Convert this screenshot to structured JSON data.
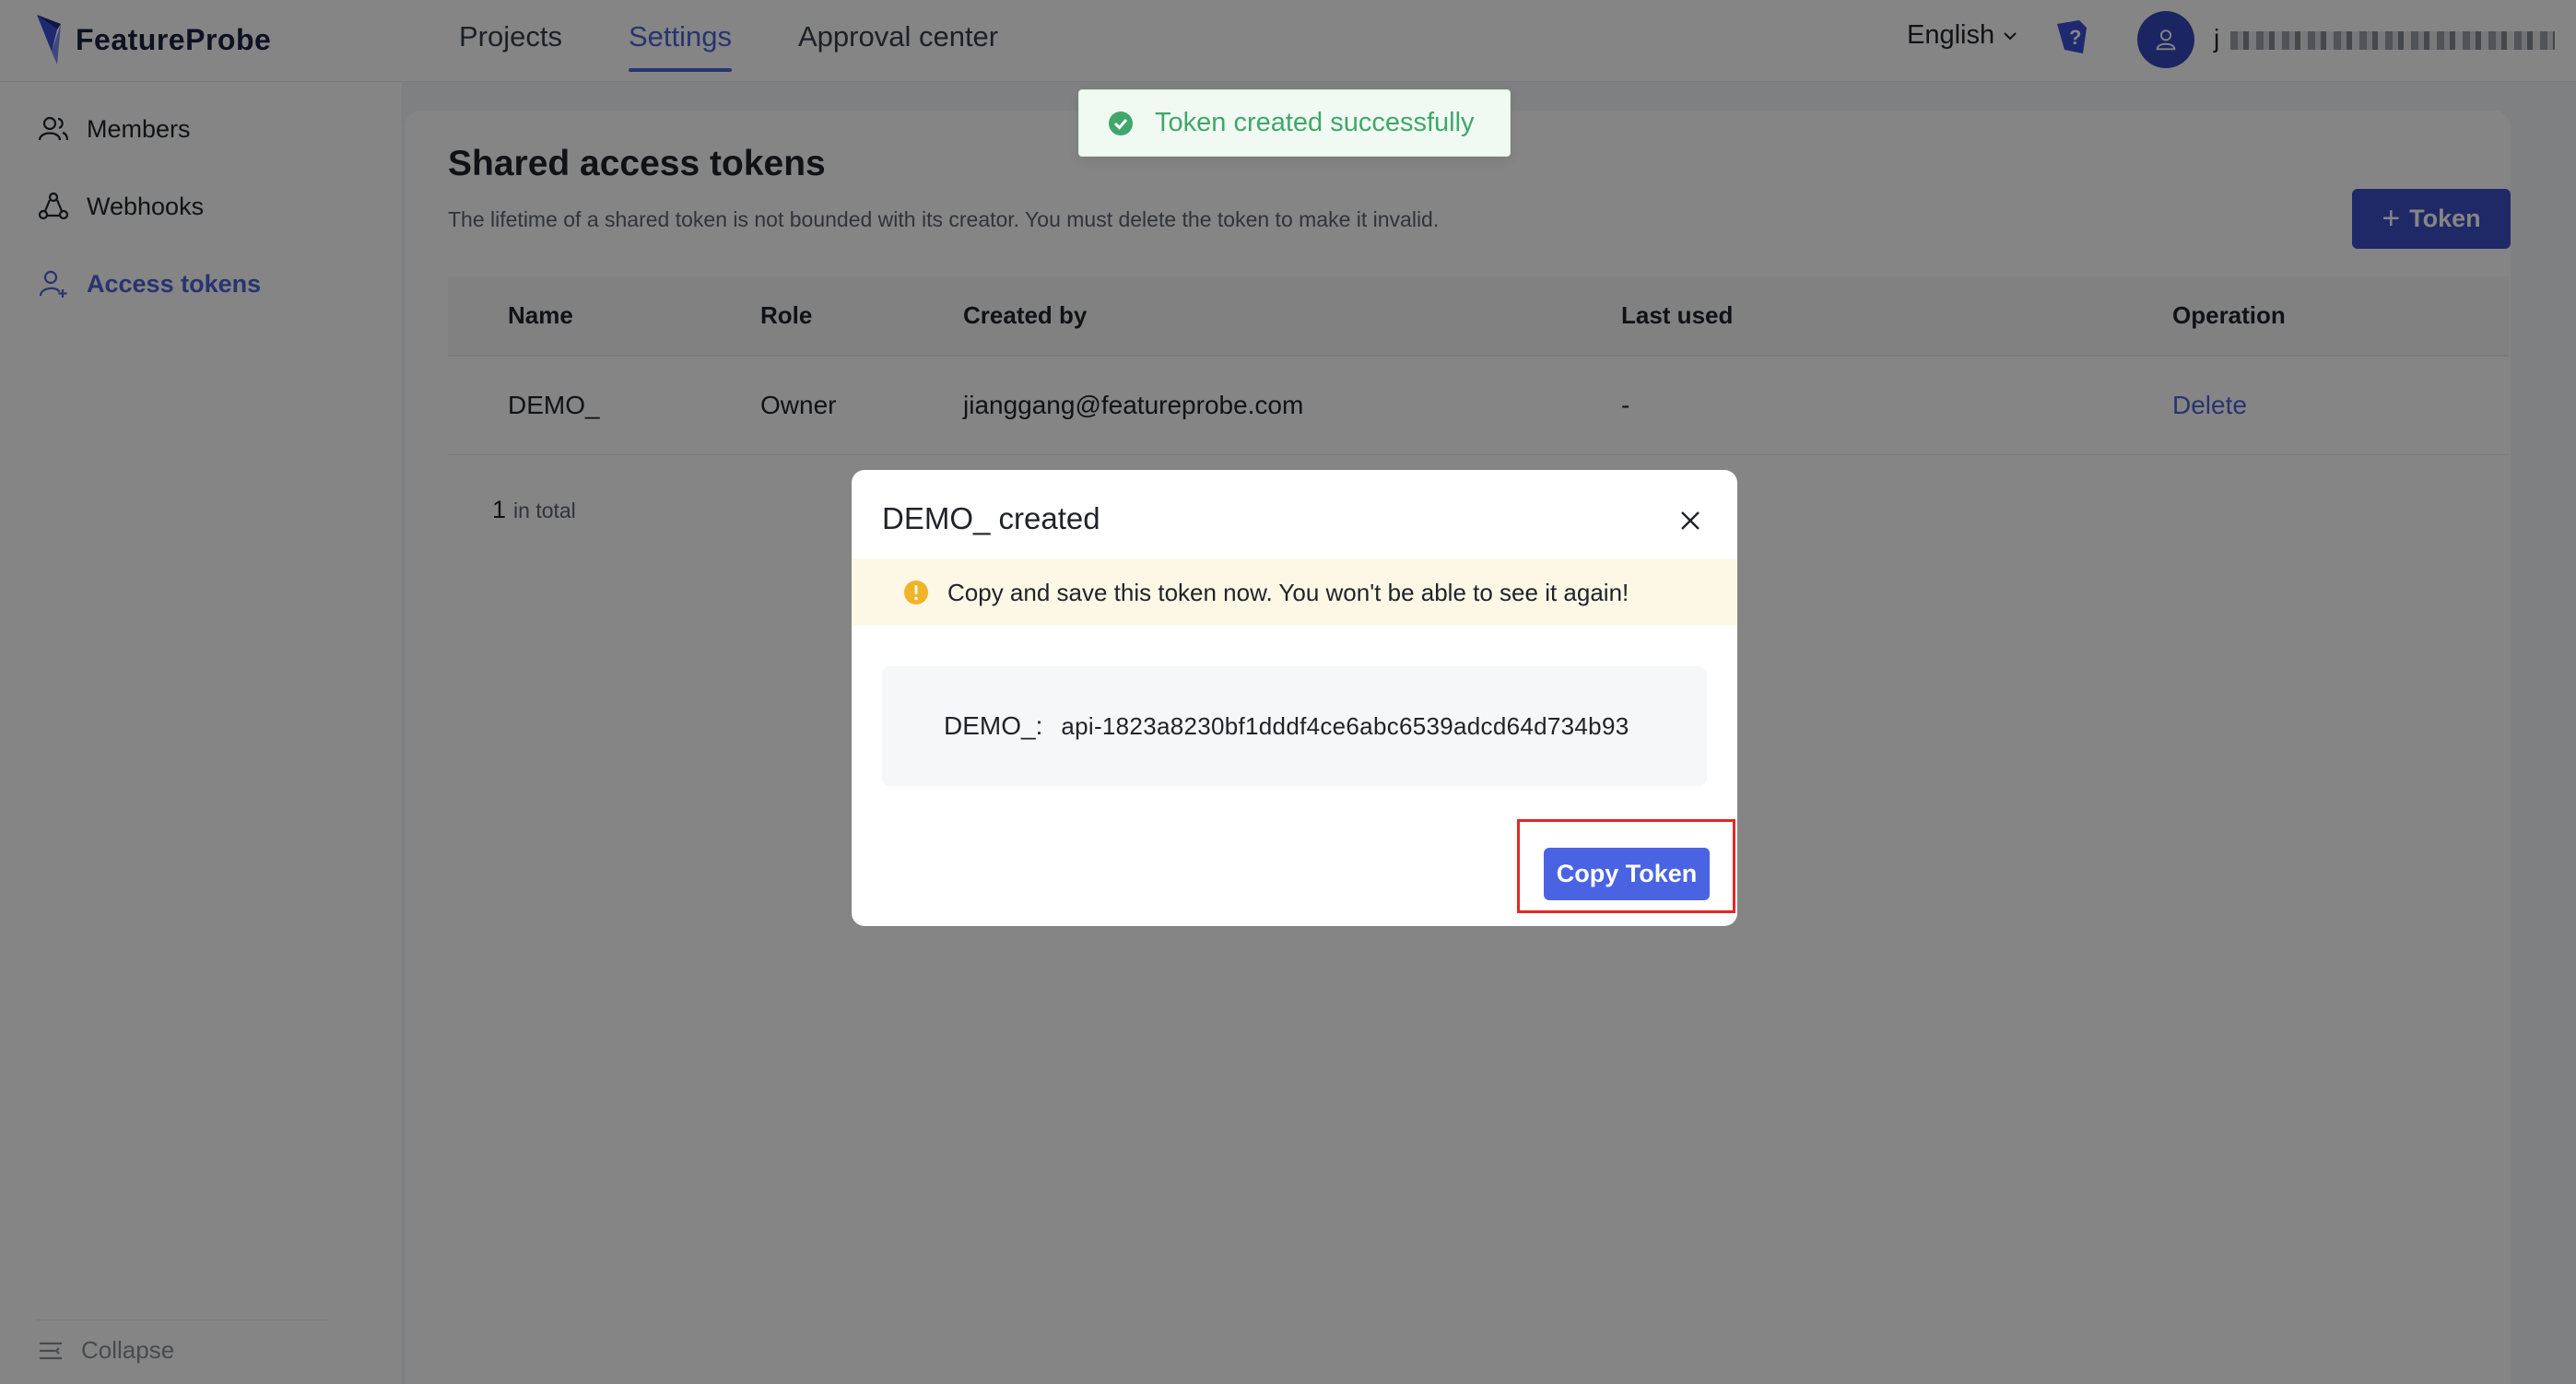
{
  "brand": {
    "name": "FeatureProbe"
  },
  "header": {
    "nav": [
      {
        "label": "Projects",
        "active": false
      },
      {
        "label": "Settings",
        "active": true
      },
      {
        "label": "Approval center",
        "active": false
      }
    ],
    "language": "English",
    "help_icon": "help-icon",
    "avatar_icon": "user-icon",
    "username_initial": "j"
  },
  "sidebar": {
    "items": [
      {
        "label": "Members",
        "icon": "members-icon",
        "active": false
      },
      {
        "label": "Webhooks",
        "icon": "webhook-icon",
        "active": false
      },
      {
        "label": "Access tokens",
        "icon": "access-token-icon",
        "active": true
      }
    ],
    "collapse_label": "Collapse"
  },
  "main": {
    "title": "Shared access tokens",
    "description": "The lifetime of a shared token is not bounded with its creator. You must delete the token to make it invalid.",
    "add_button": "Token",
    "columns": [
      "Name",
      "Role",
      "Created by",
      "Last used",
      "Operation"
    ],
    "rows": [
      {
        "name": "DEMO_",
        "role": "Owner",
        "created_by": "jianggang@featureprobe.com",
        "last_used": "-",
        "operation": "Delete"
      }
    ],
    "total_count": "1",
    "total_suffix": "in total"
  },
  "toast": {
    "message": "Token created successfully"
  },
  "modal": {
    "title": "DEMO_ created",
    "warning": "Copy and save this token now. You won't be able to see it again!",
    "token_label": "DEMO_:",
    "token_value": "api-1823a8230bf1dddf4ce6abc6539adcd64d734b93",
    "copy_button": "Copy Token"
  },
  "colors": {
    "primary": "#4d64d6",
    "button": "#3d4fc6",
    "success": "#3fa76a",
    "warning": "#f0b429",
    "highlight_box": "#e12828"
  }
}
